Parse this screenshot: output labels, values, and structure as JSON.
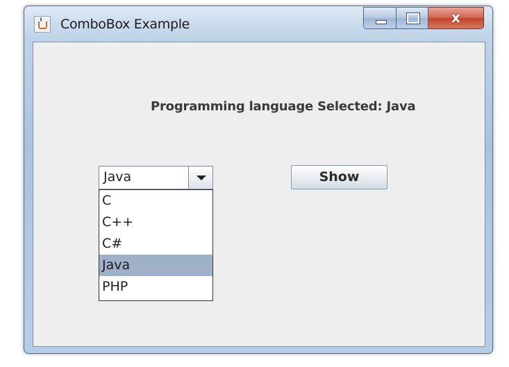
{
  "window": {
    "title": "ComboBox Example",
    "controls": {
      "minimize": "minimize",
      "maximize": "maximize",
      "close_glyph": "x"
    }
  },
  "content": {
    "result_label": "Programming language Selected: Java",
    "combo": {
      "selected_value": "Java",
      "options": [
        "C",
        "C++",
        "C#",
        "Java",
        "PHP"
      ],
      "highlighted_index": 3
    },
    "show_button": "Show"
  },
  "icons": {
    "app": "java-cup-icon",
    "dropdown_arrow": "chevron-down-icon"
  },
  "colors": {
    "selection_highlight": "#9fb1c9",
    "close_button": "#c2442b"
  }
}
